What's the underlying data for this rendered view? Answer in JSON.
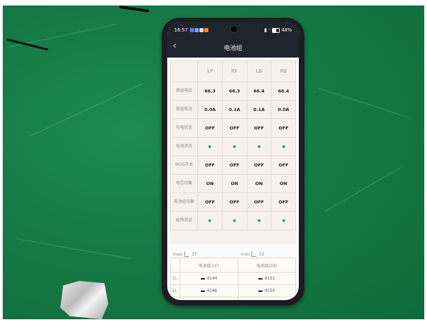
{
  "status": {
    "time": "16:57",
    "battery": "48%"
  },
  "header": {
    "title": "电池组",
    "back_icon": "chevron-left-icon"
  },
  "grid": {
    "columns": [
      "LF",
      "RF",
      "LB",
      "RB"
    ],
    "rows": [
      {
        "label": "单组电压",
        "values": [
          "66.3",
          "66.3",
          "66.4",
          "66.4"
        ]
      },
      {
        "label": "单组电流",
        "values": [
          "0.0A",
          "0.1A",
          "0.1A",
          "0.0A"
        ]
      },
      {
        "label": "充电状态",
        "values": [
          "OFF",
          "OFF",
          "OFF",
          "OFF"
        ]
      },
      {
        "label": "电池状态",
        "values": [
          "dot",
          "dot",
          "dot",
          "dot"
        ]
      },
      {
        "label": "MOS开关",
        "values": [
          "OFF",
          "OFF",
          "OFF",
          "OFF"
        ]
      },
      {
        "label": "电芯均衡",
        "values": [
          "ON",
          "ON",
          "ON",
          "ON"
        ]
      },
      {
        "label": "电池组均衡",
        "values": [
          "OFF",
          "OFF",
          "OFF",
          "OFF"
        ]
      },
      {
        "label": "故障状态",
        "values": [
          "dot",
          "dot",
          "dot",
          "dot"
        ]
      }
    ],
    "status_dot_color": "#1fb24a"
  },
  "temps": {
    "max_label": "max",
    "max_value": "37",
    "min_label": "min",
    "min_value": "32"
  },
  "cells": {
    "columns": [
      "电池组1(F)",
      "电池组2(B)"
    ],
    "rows": [
      {
        "index": "1L",
        "values": [
          "4144",
          "4151"
        ]
      },
      {
        "index": "2L",
        "values": [
          "4146",
          "4150"
        ]
      },
      {
        "index": "3L",
        "values": [
          "4144",
          "4148"
        ]
      }
    ]
  }
}
